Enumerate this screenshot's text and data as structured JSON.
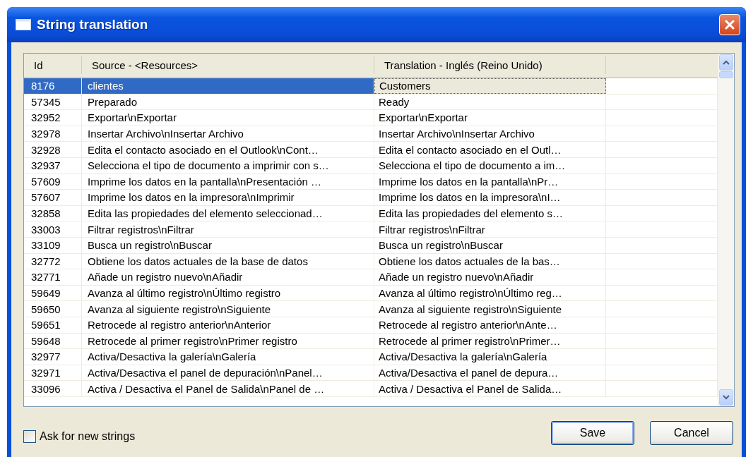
{
  "window": {
    "title": "String translation"
  },
  "table": {
    "columns": [
      "Id",
      "Source - <Resources>",
      "Translation - Inglés (Reino Unido)"
    ],
    "rows": [
      {
        "id": "8176",
        "source": "clientes",
        "translation": "Customers",
        "selected": true
      },
      {
        "id": "57345",
        "source": "Preparado",
        "translation": "Ready",
        "selected": false
      },
      {
        "id": "32952",
        "source": "Exportar\\nExportar",
        "translation": "Exportar\\nExportar",
        "selected": false
      },
      {
        "id": "32978",
        "source": "Insertar Archivo\\nInsertar Archivo",
        "translation": "Insertar Archivo\\nInsertar Archivo",
        "selected": false
      },
      {
        "id": "32928",
        "source": "Edita el contacto asociado en el Outlook\\nCont…",
        "translation": "Edita el contacto asociado en el Outl…",
        "selected": false
      },
      {
        "id": "32937",
        "source": "Selecciona el tipo de documento a imprimir con s…",
        "translation": "Selecciona el tipo de documento a im…",
        "selected": false
      },
      {
        "id": "57609",
        "source": "Imprime los datos en la pantalla\\nPresentación …",
        "translation": "Imprime los datos en la pantalla\\nPr…",
        "selected": false
      },
      {
        "id": "57607",
        "source": "Imprime los datos en la impresora\\nImprimir",
        "translation": "Imprime los datos en la impresora\\nI…",
        "selected": false
      },
      {
        "id": "32858",
        "source": "Edita las propiedades del elemento seleccionad…",
        "translation": "Edita las propiedades del elemento s…",
        "selected": false
      },
      {
        "id": "33003",
        "source": "Filtrar registros\\nFiltrar",
        "translation": "Filtrar registros\\nFiltrar",
        "selected": false
      },
      {
        "id": "33109",
        "source": "Busca un registro\\nBuscar",
        "translation": "Busca un registro\\nBuscar",
        "selected": false
      },
      {
        "id": "32772",
        "source": "Obtiene los datos actuales de la base de datos",
        "translation": "Obtiene los datos actuales de la bas…",
        "selected": false
      },
      {
        "id": "32771",
        "source": "Añade un registro nuevo\\nAñadir",
        "translation": "Añade un registro nuevo\\nAñadir",
        "selected": false
      },
      {
        "id": "59649",
        "source": "Avanza al último registro\\nÚltimo registro",
        "translation": "Avanza al último registro\\nÚltimo reg…",
        "selected": false
      },
      {
        "id": "59650",
        "source": "Avanza al siguiente registro\\nSiguiente",
        "translation": "Avanza al siguiente registro\\nSiguiente",
        "selected": false
      },
      {
        "id": "59651",
        "source": "Retrocede al registro anterior\\nAnterior",
        "translation": "Retrocede al registro anterior\\nAnte…",
        "selected": false
      },
      {
        "id": "59648",
        "source": "Retrocede al primer registro\\nPrimer registro",
        "translation": "Retrocede al primer registro\\nPrimer…",
        "selected": false
      },
      {
        "id": "32977",
        "source": "Activa/Desactiva la galería\\nGalería",
        "translation": "Activa/Desactiva la galería\\nGalería",
        "selected": false
      },
      {
        "id": "32971",
        "source": "Activa/Desactiva el panel de depuración\\nPanel…",
        "translation": "Activa/Desactiva el panel de depura…",
        "selected": false
      },
      {
        "id": "33096",
        "source": "Activa / Desactiva el Panel de Salida\\nPanel de …",
        "translation": "Activa / Desactiva el Panel de Salida…",
        "selected": false
      }
    ]
  },
  "ask_new_strings": {
    "label": "Ask for new strings",
    "checked": false
  },
  "buttons": [
    {
      "label": "Save",
      "kind": "default"
    },
    {
      "label": "Cancel",
      "kind": "normal"
    }
  ]
}
